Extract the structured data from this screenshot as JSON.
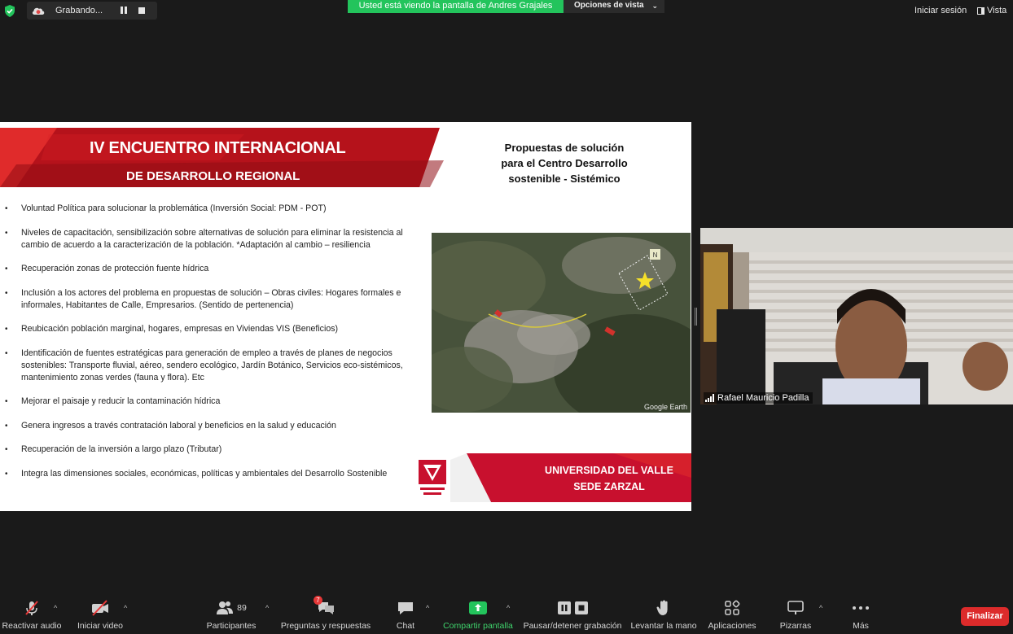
{
  "topbar": {
    "recording_text": "Grabando...",
    "share_banner": "Usted está viendo la pantalla de Andres Grajales",
    "view_options": "Opciones de vista",
    "sign_in": "Iniciar sesión",
    "view": "Vista"
  },
  "slide": {
    "banner_line1": "IV ENCUENTRO INTERNACIONAL",
    "banner_line2": "DE DESARROLLO REGIONAL",
    "title_lines": [
      "Propuestas de solución",
      "para el Centro Desarrollo",
      "sostenible - Sistémico"
    ],
    "bullets": [
      "Voluntad Política para solucionar la problemática (Inversión Social: PDM - POT)",
      "Niveles de capacitación, sensibilización sobre alternativas de solución para eliminar la resistencia al cambio de acuerdo a la caracterización de la población. *Adaptación al cambio – resiliencia",
      "Recuperación zonas de protección fuente hídrica",
      "Inclusión a los actores del problema en propuestas de solución – Obras civiles: Hogares formales e informales, Habitantes de Calle, Empresarios. (Sentido de pertenencia)",
      "Reubicación población marginal, hogares,  empresas en Viviendas VIS (Beneficios)",
      "Identificación de fuentes estratégicas para generación de empleo a través de planes de negocios sostenibles: Transporte fluvial, aéreo, sendero ecológico, Jardín Botánico, Servicios eco-sistémicos, mantenimiento zonas verdes (fauna y flora). Etc",
      "Mejorar el paisaje  y reducir la contaminación hídrica",
      "Genera ingresos a través contratación laboral y beneficios en la salud y educación",
      "Recuperación de la inversión a largo plazo (Tributar)",
      "Integra las dimensiones sociales, económicas, políticas y ambientales del Desarrollo Sostenible"
    ],
    "map_credit": "Google Earth",
    "map_north": "N",
    "footer_line1": "UNIVERSIDAD DEL VALLE",
    "footer_line2": "SEDE ZARZAL"
  },
  "participant": {
    "name": "Rafael Mauricio Padilla"
  },
  "toolbar": {
    "audio": "Reactivar audio",
    "video": "Iniciar video",
    "participants": "Participantes",
    "participants_count": "89",
    "qa": "Preguntas y respuestas",
    "qa_badge": "7",
    "chat": "Chat",
    "share": "Compartir pantalla",
    "recording": "Pausar/detener grabación",
    "raise_hand": "Levantar la mano",
    "apps": "Aplicaciones",
    "whiteboards": "Pizarras",
    "more": "Más",
    "end": "Finalizar"
  },
  "colors": {
    "accent_green": "#23c45c",
    "brand_red": "#c8102e",
    "end_red": "#dc2b2b"
  }
}
